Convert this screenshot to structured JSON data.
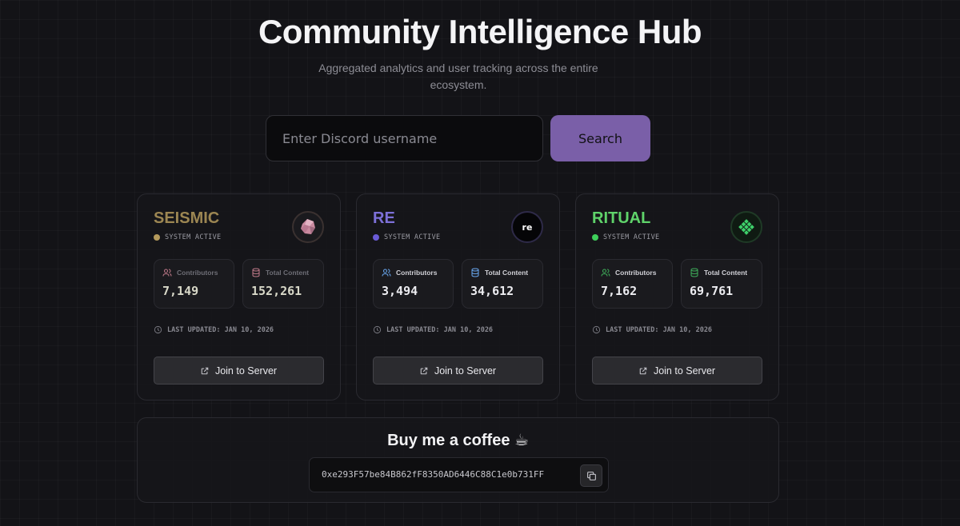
{
  "header": {
    "title": "Community Intelligence Hub",
    "subtitle": "Aggregated analytics and user tracking across the entire ecosystem."
  },
  "search": {
    "placeholder": "Enter Discord username",
    "value": "",
    "button_label": "Search"
  },
  "cards": [
    {
      "name": "SEISMIC",
      "accent": "#b49a5c",
      "status_color": "#b49a5c",
      "status": "SYSTEM ACTIVE",
      "logo_icon": "pink-crystal-icon",
      "contributors_label": "Contributors",
      "contributors": "7,149",
      "content_label": "Total Content",
      "content": "152,261",
      "updated": "LAST UPDATED: JAN 10, 2026",
      "join_label": "Join to Server"
    },
    {
      "name": "RE",
      "accent": "#7d70d8",
      "status_color": "#6a5bd6",
      "status": "SYSTEM ACTIVE",
      "logo_icon": "re-text-icon",
      "logo_text": "re",
      "contributors_label": "Contributors",
      "contributors": "3,494",
      "content_label": "Total Content",
      "content": "34,612",
      "updated": "LAST UPDATED: JAN 10, 2026",
      "join_label": "Join to Server"
    },
    {
      "name": "RITUAL",
      "accent": "#5fd36a",
      "status_color": "#3ecf5a",
      "status": "SYSTEM ACTIVE",
      "logo_icon": "green-knot-icon",
      "contributors_label": "Contributors",
      "contributors": "7,162",
      "content_label": "Total Content",
      "content": "69,761",
      "updated": "LAST UPDATED: JAN 10, 2026",
      "join_label": "Join to Server"
    }
  ],
  "coffee": {
    "title": "Buy me a coffee ☕",
    "wallet": "0xe293F57be84B862fF8350AD6446C88C1e0b731FF"
  },
  "colors": {
    "background": "#131317",
    "search_button": "#7a5fa8",
    "contributors_icon_re": "#6aa8f0",
    "content_icon_re": "#6aa8f0",
    "contributors_icon_seismic": "#c07a8a",
    "content_icon_seismic": "#c07a8a",
    "contributors_icon_ritual": "#3fae5a",
    "content_icon_ritual": "#3fae5a"
  }
}
